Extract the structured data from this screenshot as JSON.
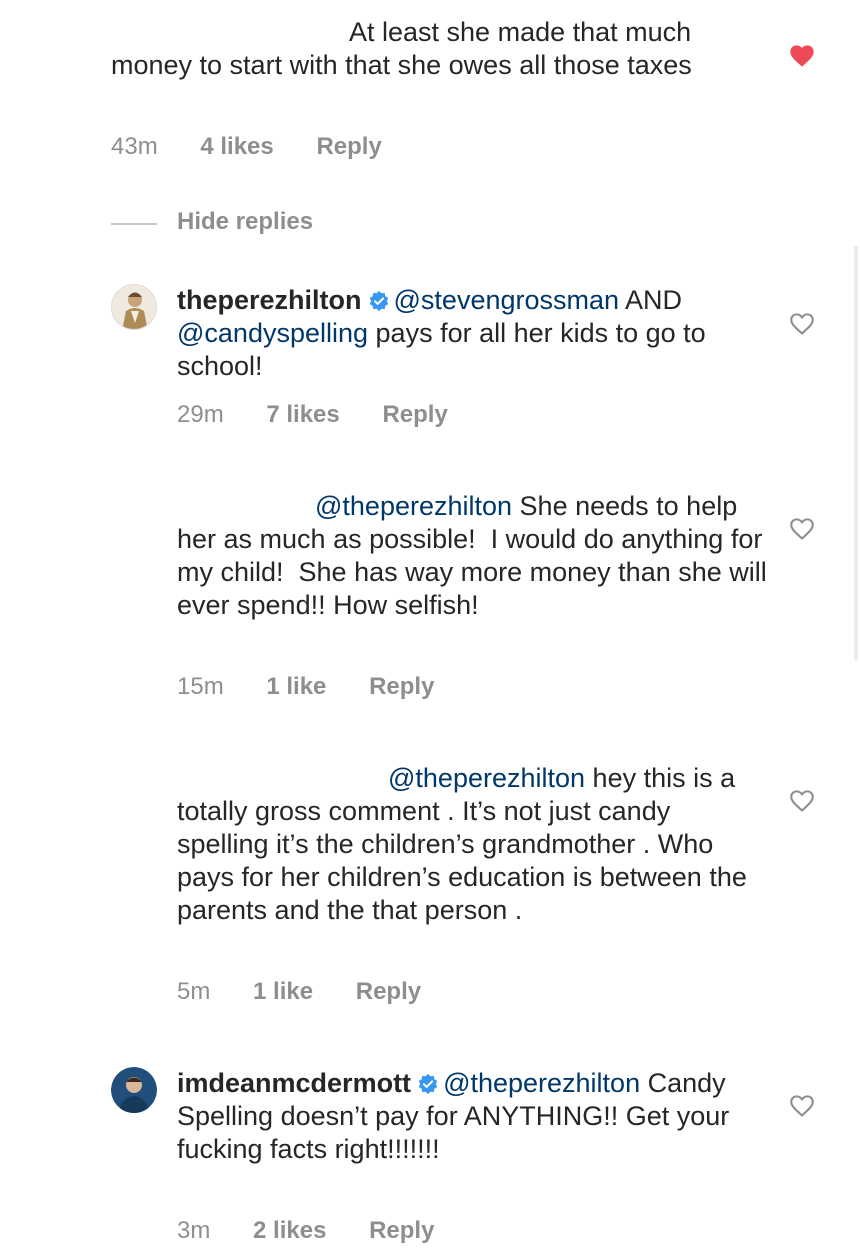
{
  "comments": [
    {
      "username": "",
      "verified": false,
      "mention": "",
      "body": "At least she made that much money to start with that she owes all those taxes",
      "time": "43m",
      "likes": "4 likes",
      "reply": "Reply",
      "liked": true
    },
    {
      "username": "theperezhilton",
      "verified": true,
      "mention": "@stevengrossman",
      "body": "AND @candyspelling pays for all her kids to go to school!",
      "time": "29m",
      "likes": "7 likes",
      "reply": "Reply",
      "liked": false
    },
    {
      "username": "",
      "verified": false,
      "mention": "@theperezhilton",
      "body": "She needs to help her as much as possible!  I would do anything for my child!  She has way more money than she will ever spend!! How selfish!",
      "time": "15m",
      "likes": "1 like",
      "reply": "Reply",
      "liked": false
    },
    {
      "username": "",
      "verified": false,
      "mention": "@theperezhilton",
      "body": "hey this is a totally gross comment . It’s not just candy spelling it’s the children’s grandmother . Who pays for her children’s education is between the parents and the that person .",
      "time": "5m",
      "likes": "1 like",
      "reply": "Reply",
      "liked": false
    },
    {
      "username": "imdeanmcdermott",
      "verified": true,
      "mention": "@theperezhilton",
      "body": "Candy Spelling doesn’t pay for ANYTHING!! Get your fucking facts right!!!!!!!",
      "time": "3m",
      "likes": "2 likes",
      "reply": "Reply",
      "liked": false
    }
  ],
  "thread": {
    "hide_replies_label": "Hide replies"
  },
  "inline_mentions": {
    "candyspelling": "@candyspelling"
  },
  "colors": {
    "heart_liked": "#ed4956",
    "mention": "#00376b",
    "meta": "#8e8e8e"
  }
}
